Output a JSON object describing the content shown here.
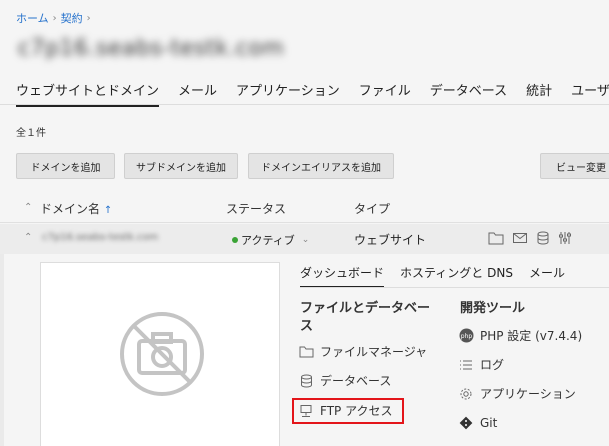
{
  "breadcrumb": {
    "home": "ホーム",
    "contract": "契約",
    "sep": "›"
  },
  "site_title": "c7p16.seabs-testk.com",
  "tabs": [
    "ウェブサイトとドメイン",
    "メール",
    "アプリケーション",
    "ファイル",
    "データベース",
    "統計",
    "ユーザ"
  ],
  "count_text": "全１件",
  "buttons": {
    "add_domain": "ドメインを追加",
    "add_subdomain": "サブドメインを追加",
    "add_alias": "ドメインエイリアスを追加",
    "view": "ビュー変更"
  },
  "table_header": {
    "domain": "ドメイン名",
    "sort_arrow": "↑",
    "status": "ステータス",
    "type": "タイプ"
  },
  "domain_row": {
    "name": "c7p16.seabs-testk.com",
    "status": "アクティブ",
    "type": "ウェブサイト",
    "status_color": "#3aa335"
  },
  "subtabs": [
    "ダッシュボード",
    "ホスティングと DNS",
    "メール"
  ],
  "files_section": {
    "title_line1": "ファイルとデータベー",
    "title_line2": "ス",
    "items": [
      "ファイルマネージャ",
      "データベース",
      "FTP アクセス"
    ]
  },
  "dev_section": {
    "title": "開発ツール",
    "items": [
      "PHP 設定 (v7.4.4)",
      "ログ",
      "アプリケーション",
      "Git"
    ]
  },
  "colors": {
    "link": "#2672cc",
    "highlight": "#e3151a"
  }
}
